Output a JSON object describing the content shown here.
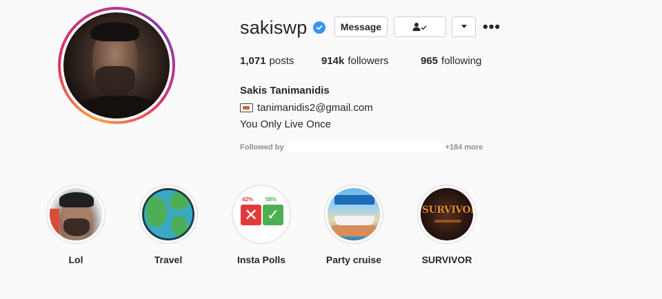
{
  "profile": {
    "username": "sakiswp",
    "verified": true,
    "full_name": "Sakis Tanimanidis",
    "email": "tanimanidis2@gmail.com",
    "bio": "You Only Live Once"
  },
  "actions": {
    "message_label": "Message",
    "follow_icon": "person-check-icon",
    "dropdown_icon": "triangle-down-icon",
    "more_icon": "more-horizontal-icon",
    "more_glyph": "•••"
  },
  "stats": {
    "posts_count": "1,071",
    "posts_label": "posts",
    "followers_count": "914k",
    "followers_label": "followers",
    "following_count": "965",
    "following_label": "following"
  },
  "followed_by": {
    "prefix": "Followed by",
    "suffix": "+184 more"
  },
  "highlights": [
    {
      "label": "Lol"
    },
    {
      "label": "Travel"
    },
    {
      "label": "Insta Polls"
    },
    {
      "label": "Party cruise"
    },
    {
      "label": "SURVIVOR"
    }
  ],
  "polls_thumb": {
    "left_pct": "42%",
    "right_pct": "58%"
  },
  "survivor_thumb": {
    "logo_text": "SURVIVOR"
  },
  "colors": {
    "verified_blue": "#3897f0",
    "ring_gradient_start": "#f9a03f",
    "ring_gradient_end": "#c13584",
    "text": "#262626",
    "muted": "#8e8e8e"
  }
}
